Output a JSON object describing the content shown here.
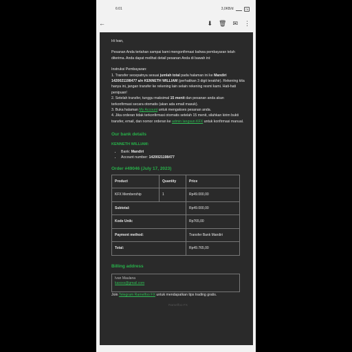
{
  "status": {
    "time": "6:01",
    "speed": "3,0KB/d",
    "battery": "79"
  },
  "toolbar": {
    "back": "←",
    "archive": "⬇",
    "delete": "🗑",
    "mail": "✉",
    "more": "⋮"
  },
  "email": {
    "greeting": "Hi Ivan,",
    "intro": "Pesanan Anda tertahan sampai kami mengonfirmasi bahwa pembayaran telah diterima. Anda dapat melihat detail pesanan Anda di bawah ini:",
    "instr_title": "Instruksi Pembayaran:",
    "step1_a": "1. Transfer secepatnya sesuai ",
    "step1_b": "jumlah total",
    "step1_c": " pada halaman ini ke ",
    "step1_d": "Mandiri 1420021198477 a/n KENNETH WILLIAM",
    "step1_e": " (perhatikan 3 digit terakhir). Rekening kita hanya ini, jangan transfer ke rekening lain selain rekening resmi kami. Hati-hati penipuan!",
    "step2_a": "2. Setelah transfer, tunggu maksimal ",
    "step2_b": "15 menit",
    "step2_c": " dan pesanan anda akan terkonfirmasi secara otomatis (akan ada email masuk).",
    "step3_a": "3. Buka halaman ",
    "step3_link": "My Account",
    "step3_b": " untuk mengakses pesanan anda.",
    "step4_a": "4. Jika orderan tidak terkonfirmasi otomatis setelah 15 menit, silahkan kirim bukti transfer, email, dan nomor orderan ke ",
    "step4_link": "admin langsun KFX",
    "step4_b": " untuk konfirmasi manual.",
    "bank_title": "Our bank details",
    "bank_name_heading": "KENNETH WILLIAM:",
    "bank_label": "Bank: ",
    "bank_value": "Mandiri",
    "acct_label": "Account number: ",
    "acct_value": "1420021198477",
    "order_title": "Order #49046 (July 17, 2023)",
    "billing_title": "Billing address",
    "billing_name": "Ivan Maulana",
    "billing_email": "kaxxxx@gmail.com",
    "join_a": "Join ",
    "join_link": "Telegram Ramelfoo FX",
    "join_b": " untuk mendapatkan tips trading gratis.",
    "footer": "Ramelfoo FX"
  },
  "order": {
    "headers": {
      "product": "Product",
      "quantity": "Quantity",
      "price": "Price"
    },
    "item": {
      "product": "KFX Membership",
      "quantity": "1",
      "price": "Rp49.000,00"
    },
    "subtotal_label": "Subtotal:",
    "subtotal_value": "Rp49.000,00",
    "kode_label": "Kode Unik:",
    "kode_value": "Rp765,00",
    "method_label": "Payment method:",
    "method_value": "Transfer Bank Mandiri",
    "total_label": "Total:",
    "total_value": "Rp49.765,00"
  }
}
